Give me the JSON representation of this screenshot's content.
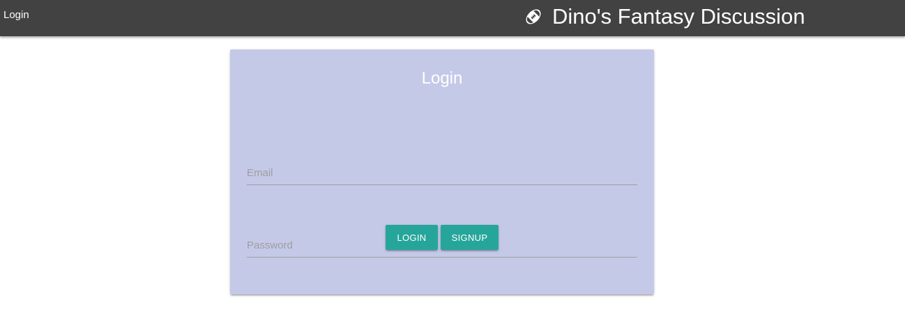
{
  "nav": {
    "login_link": "Login",
    "brand_title": "Dino's Fantasy Discussion",
    "brand_icon": "football-icon"
  },
  "card": {
    "title": "Login",
    "email": {
      "placeholder": "Email",
      "value": ""
    },
    "password": {
      "placeholder": "Password",
      "value": ""
    },
    "login_label": "LOGIN",
    "signup_label": "SIGNUP"
  },
  "colors": {
    "navbar": "#424242",
    "card_background": "#c5c9e8",
    "button": "#26a69a",
    "text_light": "#ffffff"
  }
}
